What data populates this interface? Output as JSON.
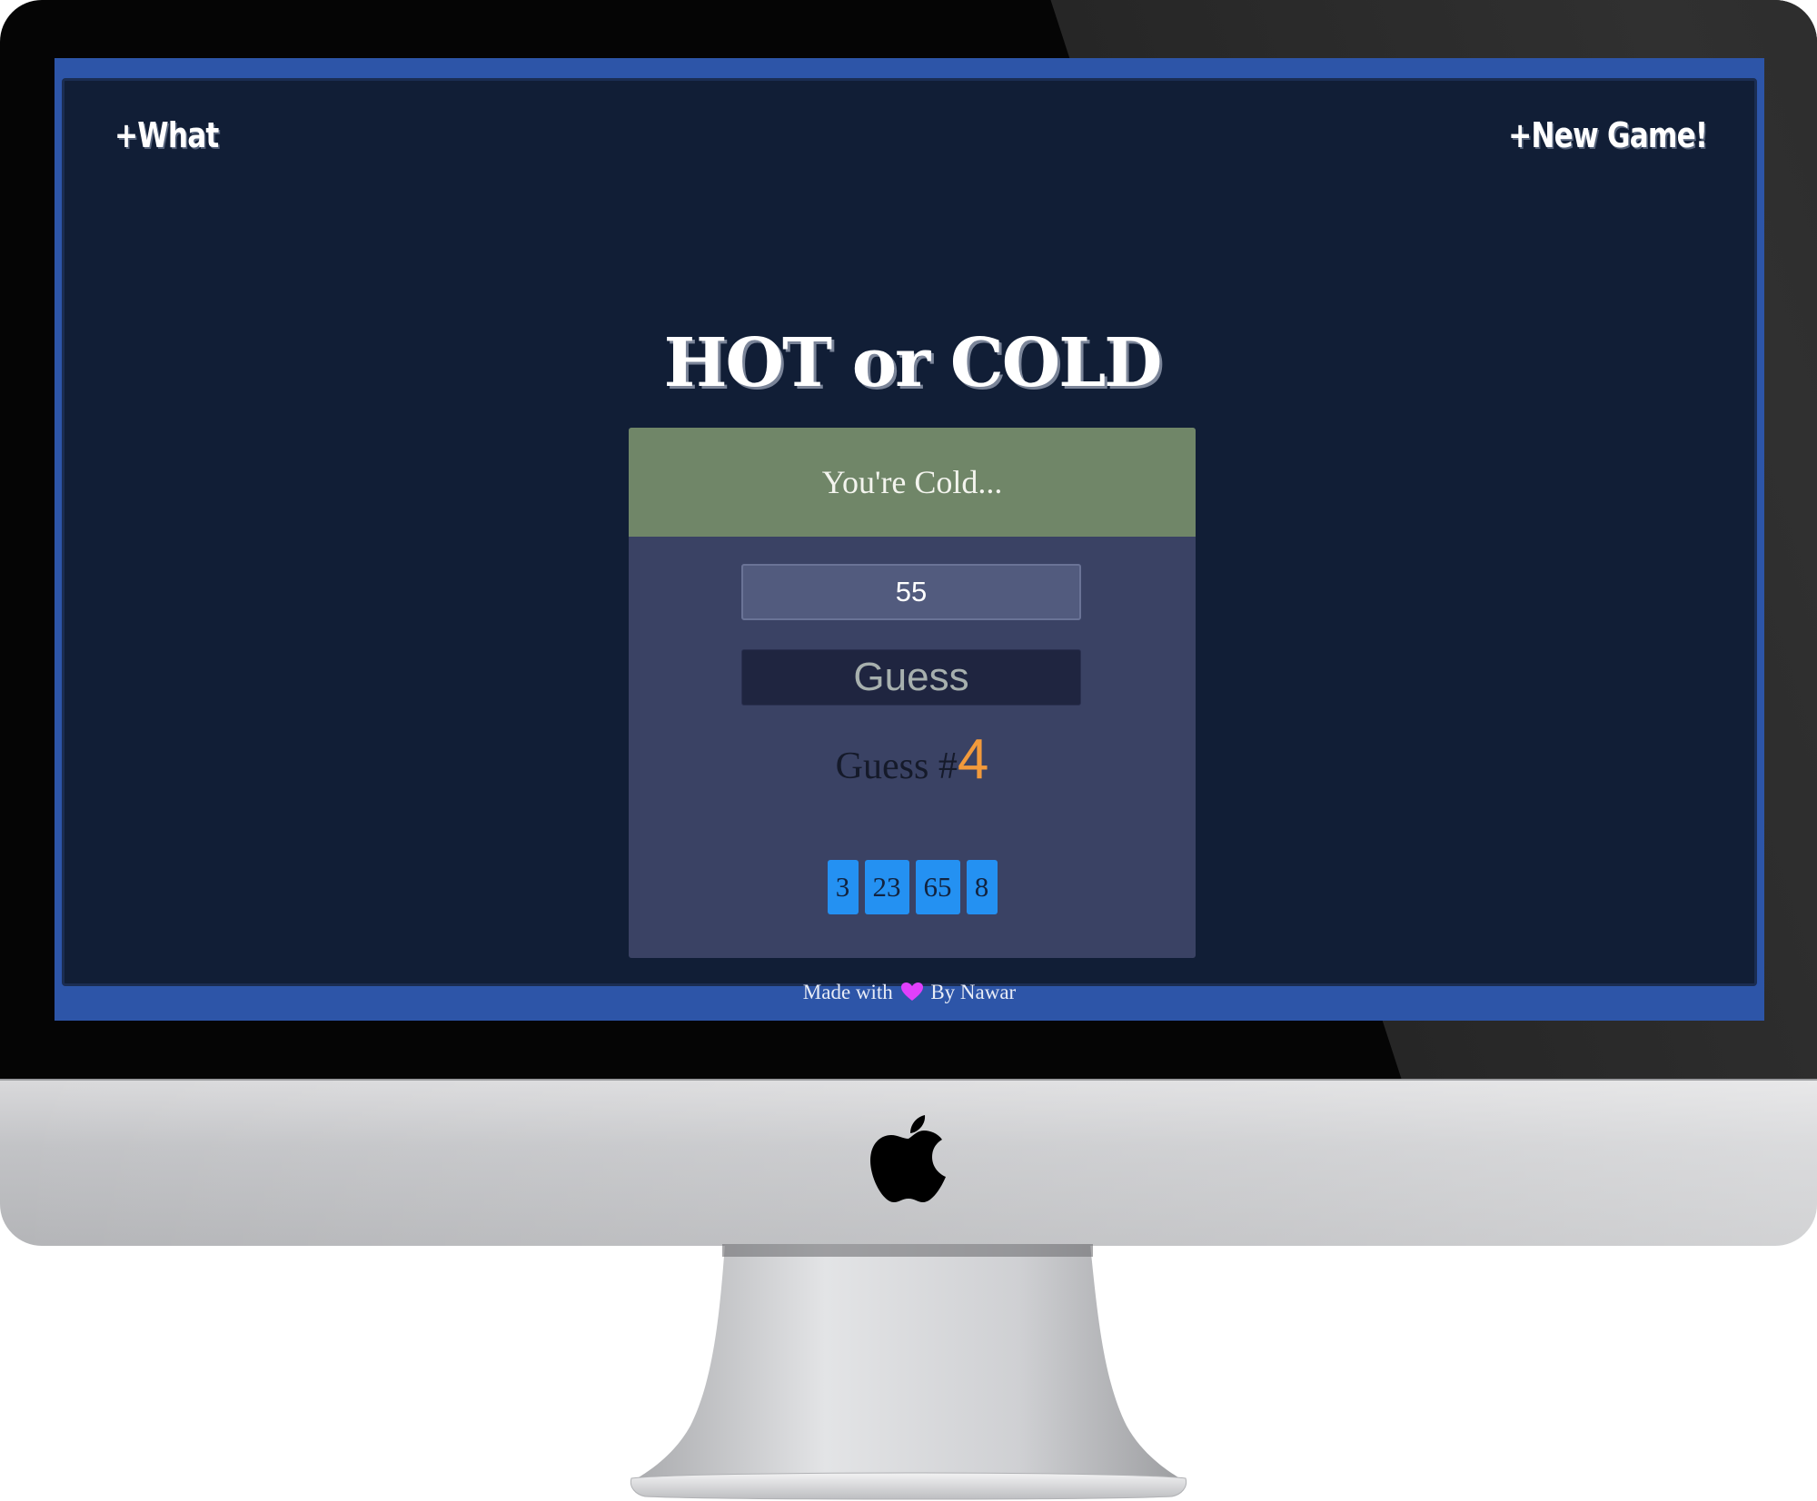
{
  "nav": {
    "what_label": "+What",
    "new_game_label": "+New Game!"
  },
  "game": {
    "title": "HOT or COLD",
    "feedback": "You're Cold...",
    "input_value": "55",
    "guess_button_label": "Guess",
    "count_prefix": "Guess #",
    "count": "4",
    "history": [
      "3",
      "23",
      "65",
      "8"
    ]
  },
  "footer": {
    "made_with": "Made with",
    "by": "By Nawar",
    "heart_icon": "heart-icon"
  },
  "colors": {
    "screen_border": "#2d55a8",
    "app_background": "#111e36",
    "card_background": "#3a4264",
    "feedback_background": "#708668",
    "history_chip": "#2491f2",
    "count_accent": "#f29a3b",
    "heart": "#e040fb"
  },
  "device": {
    "brand_icon": "apple-logo-icon"
  }
}
